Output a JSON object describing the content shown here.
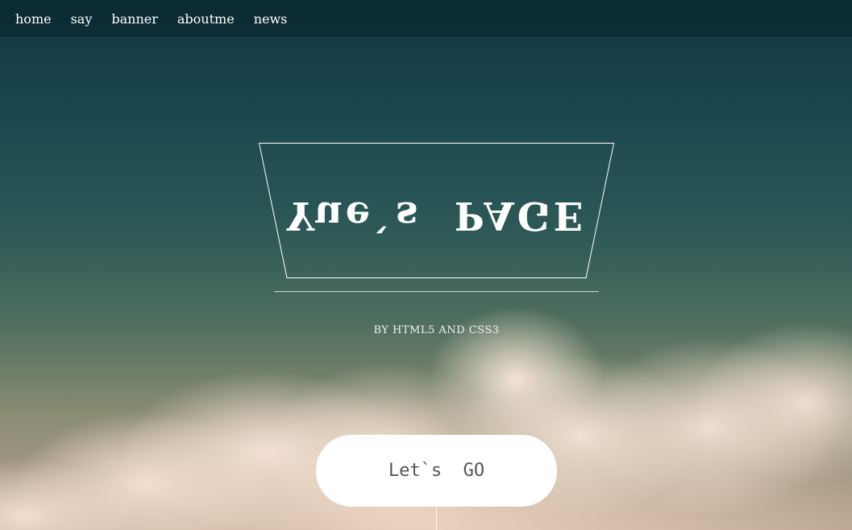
{
  "nav": {
    "items": [
      {
        "label": "home"
      },
      {
        "label": "say"
      },
      {
        "label": "banner"
      },
      {
        "label": "aboutme"
      },
      {
        "label": "news"
      }
    ]
  },
  "hero": {
    "logo_text": "Yue`s  PAGE",
    "subtitle": "BY HTML5 AND CSS3",
    "cta_label": "Let`s  GO"
  },
  "colors": {
    "sky_top": "#12363f",
    "cloud": "#f5e2d4",
    "text": "#ffffff",
    "button_bg": "#ffffff",
    "button_text": "#555555"
  }
}
